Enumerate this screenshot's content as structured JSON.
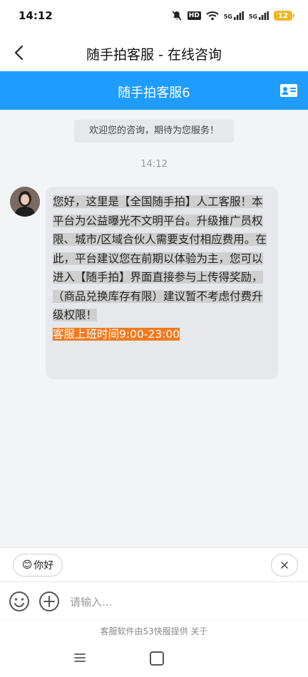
{
  "status": {
    "time": "14:12",
    "hd": "HD",
    "sig1": "5G",
    "sig2": "5G",
    "battery": "12"
  },
  "titlebar": {
    "title": "随手拍客服 - 在线咨询"
  },
  "agent": {
    "name": "随手拍客服6"
  },
  "chat": {
    "welcome": "欢迎您的咨询，期待为您服务！",
    "timestamp": "14:12",
    "message_main": "您好，这里是【全国随手拍】人工客服！本平台为公益曝光不文明平台。升级推广员权限、城市/区域合伙人需要支付相应费用。在此，平台建议您在前期以体验为主，您可以进入【随手拍】界面直接参与上传得奖励，（商品兑换库存有限）建议暂不考虑付费升级权限！",
    "message_hours": "客服上班时间9:00-23:00"
  },
  "quick_reply": {
    "emoji": "😊",
    "label": "你好"
  },
  "input": {
    "placeholder": "请输入..."
  },
  "footer": {
    "text": "客服软件由53快服提供   关于"
  },
  "colors": {
    "accent": "#1f9cff",
    "highlight": "#f37a1f"
  }
}
